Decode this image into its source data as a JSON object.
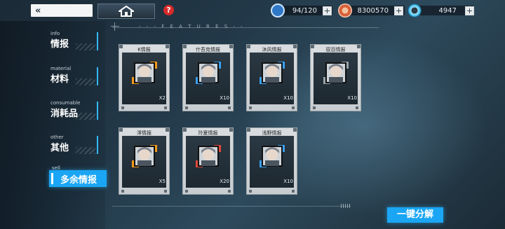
{
  "topbar": {
    "back_label": "«",
    "help_label": "?",
    "resources": [
      {
        "icon": "stamina-icon",
        "value": "94/120"
      },
      {
        "icon": "coin-icon",
        "value": "8300570"
      },
      {
        "icon": "gear-currency-icon",
        "value": "4947"
      }
    ]
  },
  "features_label": "- - - F E A T U R E S - -",
  "sidebar": {
    "items": [
      {
        "en": "info",
        "zh": "情报"
      },
      {
        "en": "material",
        "zh": "材料"
      },
      {
        "en": "consumable",
        "zh": "消耗品"
      },
      {
        "en": "other",
        "zh": "其他"
      },
      {
        "en": "sell",
        "zh": "多余情报"
      }
    ],
    "active_index": 4
  },
  "cards": [
    {
      "title": "K情报",
      "count": "X2",
      "frame": "orange"
    },
    {
      "title": "什吾克情报",
      "count": "X10",
      "frame": "blue"
    },
    {
      "title": "沐风情报",
      "count": "X10",
      "frame": "blue"
    },
    {
      "title": "驭百情报",
      "count": "X10",
      "frame": "gray"
    },
    {
      "title": "澪情报",
      "count": "X5",
      "frame": "orange"
    },
    {
      "title": "玲夏情报",
      "count": "X20",
      "frame": "red"
    },
    {
      "title": "浅野情报",
      "count": "X10",
      "frame": "blue"
    }
  ],
  "dismantle_button": "一键分解",
  "colors": {
    "accent": "#1aa6f4",
    "orange": "#f29a1c",
    "blue": "#3aa0f0",
    "red": "#e0483a",
    "gray": "#9aa3a9"
  }
}
